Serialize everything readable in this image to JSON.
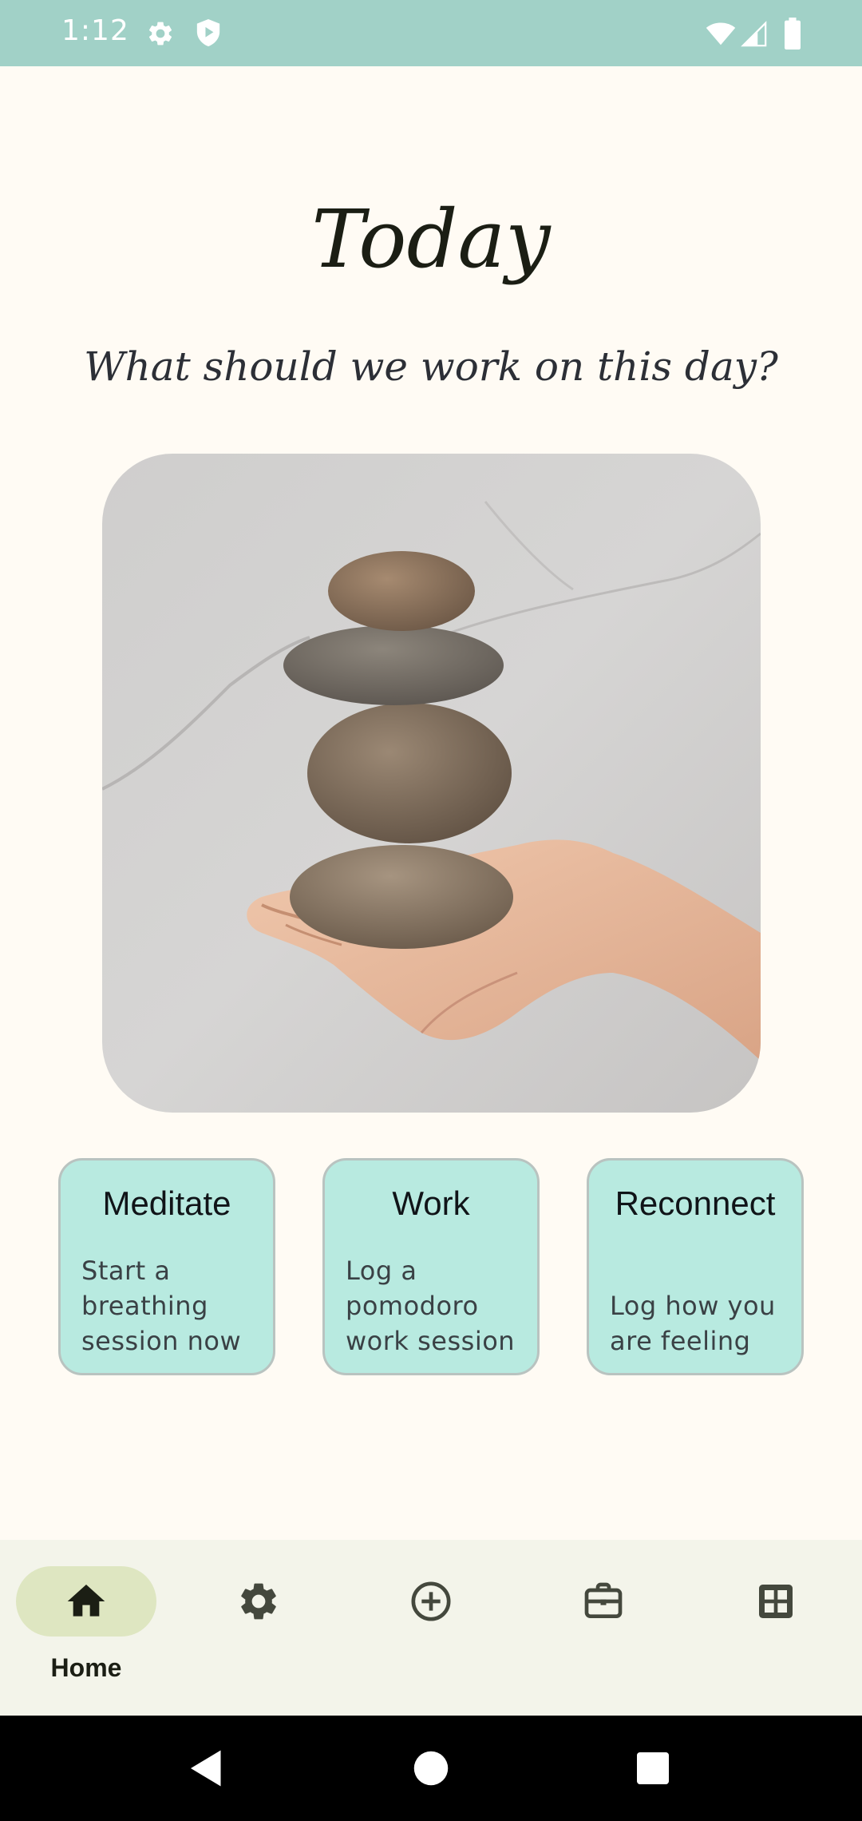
{
  "status_bar": {
    "time": "1:12",
    "icons": [
      "gear-icon",
      "shield-play-icon",
      "wifi-icon",
      "signal-icon",
      "battery-icon"
    ],
    "background": "#A1D1C7"
  },
  "header": {
    "title": "Today",
    "subtitle": "What should we work on this day?"
  },
  "hero": {
    "image_subject": "hand-holding-stacked-stones"
  },
  "cards": [
    {
      "title": "Meditate",
      "description": "Start a breathing session now"
    },
    {
      "title": "Work",
      "description": "Log a pomodoro work session"
    },
    {
      "title": "Reconnect",
      "description": "Log how you are feeling"
    }
  ],
  "bottom_nav": {
    "items": [
      {
        "label": "Home",
        "icon": "home-icon",
        "selected": true
      },
      {
        "label": "",
        "icon": "gear-icon",
        "selected": false
      },
      {
        "label": "",
        "icon": "add-circle-icon",
        "selected": false
      },
      {
        "label": "",
        "icon": "briefcase-icon",
        "selected": false
      },
      {
        "label": "",
        "icon": "grid-icon",
        "selected": false
      }
    ]
  },
  "system_nav": {
    "buttons": [
      "back-icon",
      "home-circle-icon",
      "recents-square-icon"
    ]
  },
  "colors": {
    "background": "#FFFBF4",
    "card": "#B8EAE0",
    "card_border": "#B9C3C0",
    "nav_background": "#F3F4EA",
    "nav_selected_pill": "#DEE6C1",
    "text_dark": "#1B1E14"
  }
}
